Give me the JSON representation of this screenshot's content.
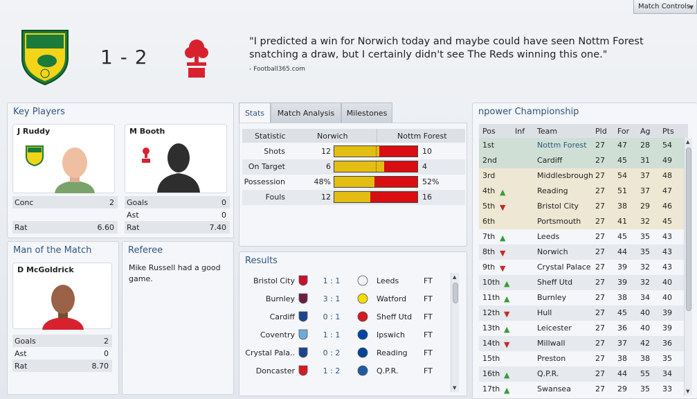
{
  "match_controls": "Match Controls",
  "header": {
    "score": "1 - 2",
    "quote": "\"I predicted a win for Norwich today and maybe could have seen Nottm Forest snatching a draw, but I certainly didn't see The Reds winning this one.\"",
    "source": "- Football365.com"
  },
  "key_players": {
    "title": "Key Players",
    "home": {
      "name": "J Ruddy",
      "stats": [
        {
          "label": "Conc",
          "value": "2"
        },
        {
          "label": "Rat",
          "value": "6.60"
        }
      ]
    },
    "away": {
      "name": "M Booth",
      "stats": [
        {
          "label": "Goals",
          "value": "0"
        },
        {
          "label": "Ast",
          "value": "0"
        },
        {
          "label": "Rat",
          "value": "7.40"
        }
      ]
    }
  },
  "motm": {
    "title": "Man of the Match",
    "name": "D McGoldrick",
    "stats": [
      {
        "label": "Goals",
        "value": "2"
      },
      {
        "label": "Ast",
        "value": "0"
      },
      {
        "label": "Rat",
        "value": "8.70"
      }
    ]
  },
  "referee": {
    "title": "Referee",
    "text": "Mike Russell had a good game."
  },
  "tabs": [
    "Stats",
    "Match Analysis",
    "Milestones"
  ],
  "stats": {
    "headers": [
      "Statistic",
      "Norwich",
      "Nottm Forest"
    ],
    "rows": [
      {
        "name": "Shots",
        "home": "12",
        "away": "10",
        "home_share": 0.545
      },
      {
        "name": "On Target",
        "home": "6",
        "away": "4",
        "home_share": 0.6
      },
      {
        "name": "Possession",
        "home": "48%",
        "away": "52%",
        "home_share": 0.48
      },
      {
        "name": "Fouls",
        "home": "12",
        "away": "16",
        "home_share": 0.43
      }
    ]
  },
  "results": {
    "title": "Results",
    "rows": [
      {
        "home": "Bristol City",
        "score": "1 : 1",
        "away": "Leeds",
        "status": "FT",
        "hc": "#c8102e",
        "ac": "#f2f2f2"
      },
      {
        "home": "Burnley",
        "score": "3 : 1",
        "away": "Watford",
        "status": "FT",
        "hc": "#6c1d45",
        "ac": "#f5d90a"
      },
      {
        "home": "Cardiff",
        "score": "0 : 1",
        "away": "Sheff Utd",
        "status": "FT",
        "hc": "#1b458f",
        "ac": "#d71920"
      },
      {
        "home": "Coventry",
        "score": "1 : 1",
        "away": "Ipswich",
        "status": "FT",
        "hc": "#6cabdd",
        "ac": "#0044a9"
      },
      {
        "home": "Crystal Pala..",
        "score": "0 : 2",
        "away": "Reading",
        "status": "FT",
        "hc": "#1b458f",
        "ac": "#004494"
      },
      {
        "home": "Doncaster",
        "score": "1 : 2",
        "away": "Q.P.R.",
        "status": "FT",
        "hc": "#d71920",
        "ac": "#1d5ba4"
      }
    ]
  },
  "league": {
    "title": "npower Championship",
    "headers": [
      "Pos",
      "Inf",
      "Team",
      "Pld",
      "For",
      "Ag",
      "Pts"
    ],
    "rows": [
      {
        "pos": "1st",
        "mv": "",
        "team": "Nottm Forest",
        "pld": "27",
        "for": "47",
        "ag": "28",
        "pts": "54",
        "zone": "promo"
      },
      {
        "pos": "2nd",
        "mv": "",
        "team": "Cardiff",
        "pld": "27",
        "for": "45",
        "ag": "31",
        "pts": "49",
        "zone": "promo"
      },
      {
        "pos": "3rd",
        "mv": "",
        "team": "Middlesbrough",
        "pld": "27",
        "for": "54",
        "ag": "37",
        "pts": "48",
        "zone": "playoff"
      },
      {
        "pos": "4th",
        "mv": "up",
        "team": "Reading",
        "pld": "27",
        "for": "51",
        "ag": "37",
        "pts": "47",
        "zone": "playoff"
      },
      {
        "pos": "5th",
        "mv": "down",
        "team": "Bristol City",
        "pld": "27",
        "for": "38",
        "ag": "29",
        "pts": "46",
        "zone": "playoff"
      },
      {
        "pos": "6th",
        "mv": "",
        "team": "Portsmouth",
        "pld": "27",
        "for": "41",
        "ag": "32",
        "pts": "45",
        "zone": "playoff"
      },
      {
        "pos": "7th",
        "mv": "up",
        "team": "Leeds",
        "pld": "27",
        "for": "45",
        "ag": "35",
        "pts": "43",
        "zone": ""
      },
      {
        "pos": "8th",
        "mv": "down",
        "team": "Norwich",
        "pld": "27",
        "for": "44",
        "ag": "35",
        "pts": "43",
        "zone": "alt"
      },
      {
        "pos": "9th",
        "mv": "down",
        "team": "Crystal Palace",
        "pld": "27",
        "for": "39",
        "ag": "32",
        "pts": "43",
        "zone": ""
      },
      {
        "pos": "10th",
        "mv": "up",
        "team": "Sheff Utd",
        "pld": "27",
        "for": "39",
        "ag": "32",
        "pts": "40",
        "zone": "alt"
      },
      {
        "pos": "11th",
        "mv": "up",
        "team": "Burnley",
        "pld": "27",
        "for": "38",
        "ag": "34",
        "pts": "40",
        "zone": ""
      },
      {
        "pos": "12th",
        "mv": "down",
        "team": "Hull",
        "pld": "27",
        "for": "45",
        "ag": "40",
        "pts": "39",
        "zone": "alt"
      },
      {
        "pos": "13th",
        "mv": "up",
        "team": "Leicester",
        "pld": "27",
        "for": "36",
        "ag": "40",
        "pts": "39",
        "zone": ""
      },
      {
        "pos": "14th",
        "mv": "down",
        "team": "Millwall",
        "pld": "27",
        "for": "37",
        "ag": "42",
        "pts": "36",
        "zone": "alt"
      },
      {
        "pos": "15th",
        "mv": "",
        "team": "Preston",
        "pld": "27",
        "for": "38",
        "ag": "38",
        "pts": "35",
        "zone": ""
      },
      {
        "pos": "16th",
        "mv": "up",
        "team": "Q.P.R.",
        "pld": "27",
        "for": "44",
        "ag": "55",
        "pts": "34",
        "zone": "alt"
      },
      {
        "pos": "17th",
        "mv": "up",
        "team": "Swansea",
        "pld": "27",
        "for": "29",
        "ag": "35",
        "pts": "33",
        "zone": ""
      }
    ]
  },
  "colors": {
    "accent": "#2f5580",
    "home_bar": "#e4bd13",
    "away_bar": "#d90d12"
  }
}
